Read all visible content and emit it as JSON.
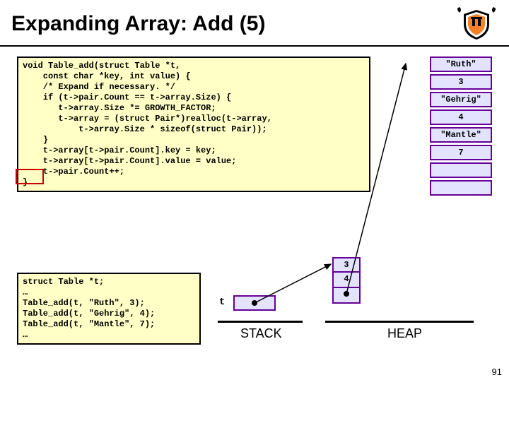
{
  "title": "Expanding Array: Add (5)",
  "code_main": "void Table_add(struct Table *t,\n    const char *key, int value) {\n    /* Expand if necessary. */\n    if (t->pair.Count == t->array.Size) {\n       t->array.Size *= GROWTH_FACTOR;\n       t->array = (struct Pair*)realloc(t->array,\n           t->array.Size * sizeof(struct Pair));\n    }\n    t->array[t->pair.Count].key = key;\n    t->array[t->pair.Count].value = value;\n    t->pair.Count++;\n}",
  "code_second": "struct Table *t;\n…\nTable_add(t, \"Ruth\", 3);\nTable_add(t, \"Gehrig\", 4);\nTable_add(t, \"Mantle\", 7);\n…",
  "cells": {
    "r0": "\"Ruth\"",
    "r1": "3",
    "r2": "\"Gehrig\"",
    "r3": "4",
    "r4": "\"Mantle\"",
    "r5": "7",
    "r6": "",
    "r7": ""
  },
  "heap_struct": {
    "c0": "3",
    "c1": "4",
    "c2": ""
  },
  "labels": {
    "t": "t",
    "stack": "STACK",
    "heap": "HEAP"
  },
  "page_number": "91"
}
